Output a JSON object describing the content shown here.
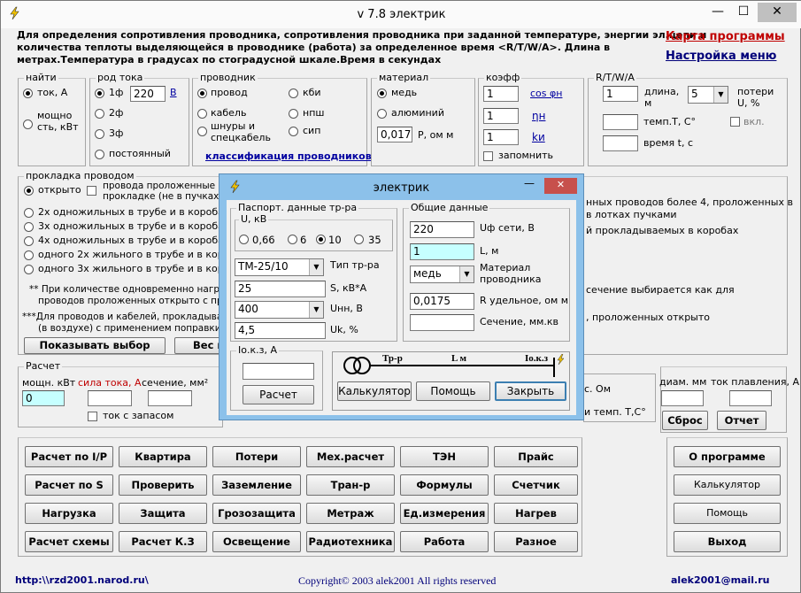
{
  "window": {
    "title": "v 7.8 электрик",
    "minimize": "—",
    "maximize": "☐",
    "close": "✕"
  },
  "header": {
    "desc_line1": "Для определения сопротивления проводника, сопротивления проводника при заданной температуре, энергии эл.цепи и",
    "desc_line2": "количества теплоты выделяющейся в проводнике (работа) за определенное время <R/T/W/A>. Длина в",
    "desc_line3": "метрах.Температура в градусах по стоградусной шкале.Время в секундах",
    "map_link": "Карта программы",
    "settings_link": "Настройка меню"
  },
  "find": {
    "label": "найти",
    "opt1": "ток, А",
    "opt2": "мощно сть, кВт"
  },
  "current": {
    "label": "род тока",
    "opt1": "1ф",
    "opt2": "2ф",
    "opt3": "3ф",
    "opt4": "постоянный",
    "voltage": "220",
    "unit": "В"
  },
  "conductor": {
    "label": "проводник",
    "opt1": "провод",
    "opt2": "кабель",
    "opt3": "шнуры и спецкабель",
    "opt4": "кби",
    "opt5": "нпш",
    "opt6": "сип",
    "link": "классификация проводников"
  },
  "material": {
    "label": "материал",
    "opt1": "медь",
    "opt2": "алюминий",
    "value": "0,0175",
    "unit": "Р, ом м"
  },
  "coeff": {
    "label": "коэфф",
    "v1": "1",
    "v2": "1",
    "v3": "1",
    "l1": "cos φн",
    "l2": "ηн",
    "l3": "kи",
    "remember": "запомнить"
  },
  "rtwa": {
    "label": "R/T/W/A",
    "v1": "1",
    "length_label": "длина, м",
    "combo": "5",
    "loss_label": "потери U, %",
    "temp_label": "темп.Т, С°",
    "time_label": "время t, с",
    "vkl": "вкл."
  },
  "laying": {
    "label": "прокладка проводом",
    "opt1": "открыто",
    "opt1b": "провода проложенные в л",
    "opt1c": "прокладке (не в пучках)",
    "opt2": "2х одножильных в трубе и в коробах, а т",
    "opt3": "3х одножильных в трубе и в коробах, а т",
    "opt4": "4х одножильных в трубе и в коробах, а т",
    "opt5": "одного 2х жильного в трубе и в коробах",
    "opt6": "одного 3х жильного в трубе и в коробах",
    "note1a": "** При количестве одновременно нагруже",
    "note1b": "проводов проложенных открыто с прим",
    "note2a": "***Для проводов и кабелей, прокладываем",
    "note2b": "(в воздухе) с применением поправки ***",
    "right1": "нных проводов более 4, проложенных в",
    "right2": "в лотках пучками",
    "right3": "й прокладываемых в коробах",
    "right4": "сечение выбирается как для",
    "right5": ", проложенных открыто",
    "show_btn": "Показывать выбор",
    "weight_btn": "Вес м"
  },
  "calc": {
    "label": "Расчет",
    "power": "мощн. кВт",
    "current": "сила тока, А",
    "section": "сечение, мм²",
    "power_val": "0",
    "reserve": "ток с запасом",
    "ohm": "с. Ом",
    "temp": "и темп. Т,С°",
    "diam": "диам. мм",
    "melt": "ток плавления, А",
    "reset": "Сброс",
    "report": "Отчет"
  },
  "buttons": {
    "b1": "Расчет по I/P",
    "b2": "Квартира",
    "b3": "Потери",
    "b4": "Мех.расчет",
    "b5": "ТЭН",
    "b6": "Прайс",
    "b7": "Расчет по S",
    "b8": "Проверить",
    "b9": "Заземление",
    "b10": "Тран-р",
    "b11": "Формулы",
    "b12": "Счетчик",
    "b13": "Нагрузка",
    "b14": "Защита",
    "b15": "Грозозащита",
    "b16": "Метраж",
    "b17": "Ед.измерения",
    "b18": "Нагрев",
    "b19": "Расчет схемы",
    "b20": "Расчет К.З",
    "b21": "Освещение",
    "b22": "Радиотехника",
    "b23": "Работа",
    "b24": "Разное",
    "about": "О программе",
    "calculator": "Калькулятор",
    "help": "Помощь",
    "exit": "Выход"
  },
  "footer": {
    "site": "http:\\\\rzd2001.narod.ru\\",
    "copyright": "Copyright© 2003 alek2001 All rights reserved",
    "email": "alek2001@mail.ru"
  },
  "dialog": {
    "title": "электрик",
    "passport": "Паспорт. данные тр-ра",
    "u_label": "U, кВ",
    "u1": "0,66",
    "u2": "6",
    "u3": "10",
    "u4": "35",
    "type": "ТМ-25/10",
    "type_label": "Тип тр-ра",
    "s_val": "25",
    "s_label": "S, кВ*А",
    "unn_val": "400",
    "unn_label": "Uнн, В",
    "uk_val": "4,5",
    "uk_label": "Uk, %",
    "general": "Общие данные",
    "uf_val": "220",
    "uf_label": "Uф сети, В",
    "l_val": "1",
    "l_label": "L, м",
    "mat_val": "медь",
    "mat_label": "Материал проводника",
    "r_val": "0,0175",
    "r_label": "R удельное, ом м",
    "sec_label": "Сечение, мм.кв",
    "ikz_label": "Iо.к.з, А",
    "calc_btn": "Расчет",
    "calculator_btn": "Калькулятор",
    "help_btn": "Помощь",
    "close_btn": "Закрыть",
    "diag_tr": "Тр-р",
    "diag_l": "L м",
    "diag_ikz": "Iо.к.з"
  }
}
